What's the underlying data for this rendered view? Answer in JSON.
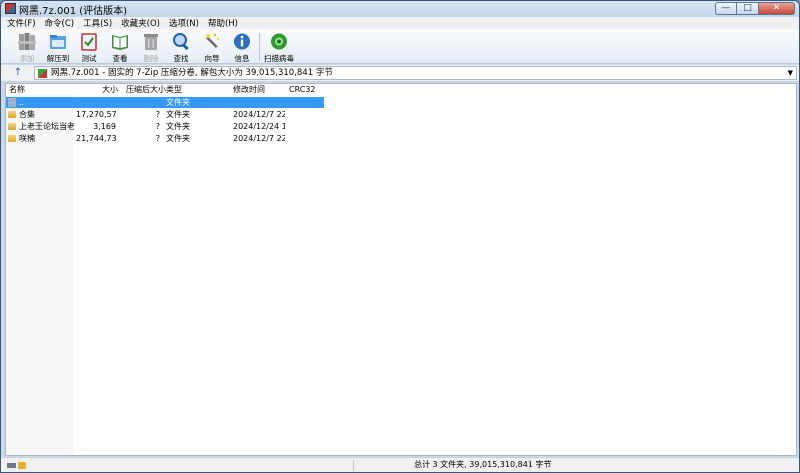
{
  "window": {
    "title": "网黑.7z.001 (评估版本)",
    "minimize": "—",
    "maximize": "□",
    "close": "✕"
  },
  "menu": [
    "文件(F)",
    "命令(C)",
    "工具(S)",
    "收藏夹(O)",
    "选项(N)",
    "帮助(H)"
  ],
  "toolbar": {
    "add": "添加",
    "extract": "解压到",
    "test": "测试",
    "view": "查看",
    "delete": "删除",
    "find": "查找",
    "wizard": "向导",
    "info": "信息",
    "scan": "扫描病毒"
  },
  "address": {
    "up": "↑",
    "path": "网黑.7z.001 - 固实的 7-Zip 压缩分卷, 解包大小为 39,015,310,841 字节",
    "dropdown": "▼"
  },
  "columns": {
    "name": "名称",
    "size": "大小",
    "packed": "压缩后大小",
    "type": "类型",
    "modified": "修改时间",
    "crc": "CRC32"
  },
  "rows": [
    {
      "name": "..",
      "size": "",
      "packed": "",
      "type": "文件夹",
      "modified": "",
      "crc": ""
    },
    {
      "name": "合集",
      "size": "17,270,57...",
      "packed": "?",
      "type": "文件夹",
      "modified": "2024/12/7 22...",
      "crc": ""
    },
    {
      "name": "上老王论坛当老王",
      "size": "3,169",
      "packed": "?",
      "type": "文件夹",
      "modified": "2024/12/24 1...",
      "crc": ""
    },
    {
      "name": "咲楠",
      "size": "21,744,73...",
      "packed": "?",
      "type": "文件夹",
      "modified": "2024/12/7 22...",
      "crc": ""
    }
  ],
  "status": {
    "total": "总计 3 文件夹, 39,015,310,841 字节"
  }
}
